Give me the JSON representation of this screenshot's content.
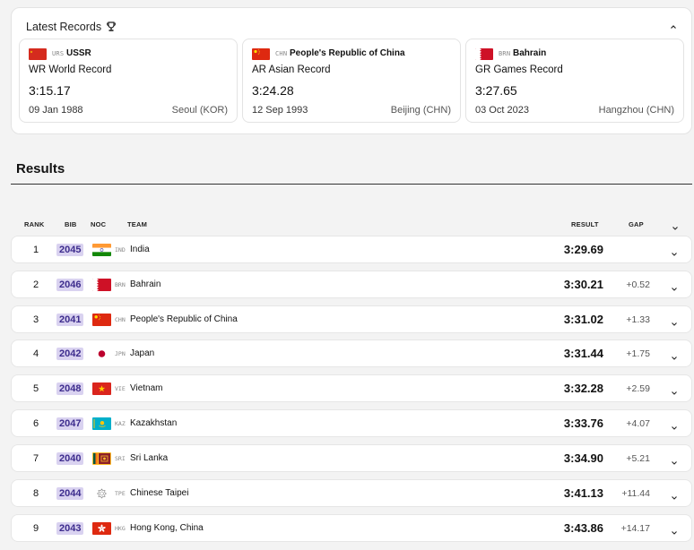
{
  "records": {
    "header": "Latest Records",
    "cards": [
      {
        "code": "URS",
        "country": "USSR",
        "type": "WR  World Record",
        "time": "3:15.17",
        "date": "09 Jan 1988",
        "place": "Seoul (KOR)",
        "flag": "urs"
      },
      {
        "code": "CHN",
        "country": "People's Republic of China",
        "type": "AR  Asian Record",
        "time": "3:24.28",
        "date": "12 Sep 1993",
        "place": "Beijing (CHN)",
        "flag": "chn"
      },
      {
        "code": "BRN",
        "country": "Bahrain",
        "type": "GR  Games Record",
        "time": "3:27.65",
        "date": "03 Oct 2023",
        "place": "Hangzhou (CHN)",
        "flag": "brn"
      }
    ]
  },
  "results": {
    "title": "Results",
    "columns": {
      "rank": "RANK",
      "bib": "BIB",
      "noc": "NOC",
      "team": "TEAM",
      "result": "RESULT",
      "gap": "GAP"
    },
    "rows": [
      {
        "rank": "1",
        "bib": "2045",
        "code": "IND",
        "team": "India",
        "result": "3:29.69",
        "gap": "",
        "flag": "ind"
      },
      {
        "rank": "2",
        "bib": "2046",
        "code": "BRN",
        "team": "Bahrain",
        "result": "3:30.21",
        "gap": "+0.52",
        "flag": "brn"
      },
      {
        "rank": "3",
        "bib": "2041",
        "code": "CHN",
        "team": "People's Republic of China",
        "result": "3:31.02",
        "gap": "+1.33",
        "flag": "chn"
      },
      {
        "rank": "4",
        "bib": "2042",
        "code": "JPN",
        "team": "Japan",
        "result": "3:31.44",
        "gap": "+1.75",
        "flag": "jpn"
      },
      {
        "rank": "5",
        "bib": "2048",
        "code": "VIE",
        "team": "Vietnam",
        "result": "3:32.28",
        "gap": "+2.59",
        "flag": "vie"
      },
      {
        "rank": "6",
        "bib": "2047",
        "code": "KAZ",
        "team": "Kazakhstan",
        "result": "3:33.76",
        "gap": "+4.07",
        "flag": "kaz"
      },
      {
        "rank": "7",
        "bib": "2040",
        "code": "SRI",
        "team": "Sri Lanka",
        "result": "3:34.90",
        "gap": "+5.21",
        "flag": "sri"
      },
      {
        "rank": "8",
        "bib": "2044",
        "code": "TPE",
        "team": "Chinese Taipei",
        "result": "3:41.13",
        "gap": "+11.44",
        "flag": "tpe"
      },
      {
        "rank": "9",
        "bib": "2043",
        "code": "HKG",
        "team": "Hong Kong, China",
        "result": "3:43.86",
        "gap": "+14.17",
        "flag": "hkg"
      }
    ]
  },
  "colors": {
    "bib_bg": "#d9d2f0",
    "bib_text": "#3d2c8d",
    "panel_bg": "#ffffff",
    "page_bg": "#f3f3f3"
  }
}
